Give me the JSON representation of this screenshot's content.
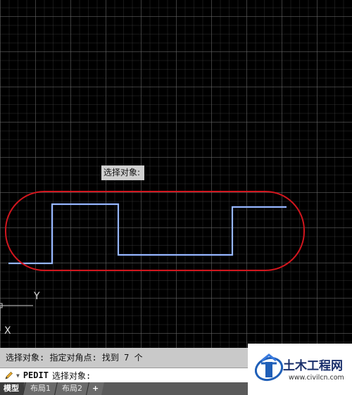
{
  "canvas": {
    "tooltip": "选择对象:",
    "ucs": {
      "y_label": "Y",
      "x_label": "X"
    },
    "colors": {
      "background": "#000000",
      "polyline": "#7fa7ff",
      "highlight_ellipse": "#d2161e",
      "ucs_axis": "#cfcfcf"
    }
  },
  "command_line": {
    "history": "选择对象: 指定对角点: 找到 7 个",
    "input": {
      "icon": "pencil-icon",
      "dropdown_icon": "chevron-down-icon",
      "command": "PEDIT",
      "prompt": "选择对象:"
    }
  },
  "tabs": {
    "items": [
      {
        "label": "模型",
        "active": true
      },
      {
        "label": "布局1",
        "active": false
      },
      {
        "label": "布局2",
        "active": false
      }
    ],
    "add_label": "+"
  },
  "watermark": {
    "title": "土木工程网",
    "url": "www.civilcn.com"
  }
}
